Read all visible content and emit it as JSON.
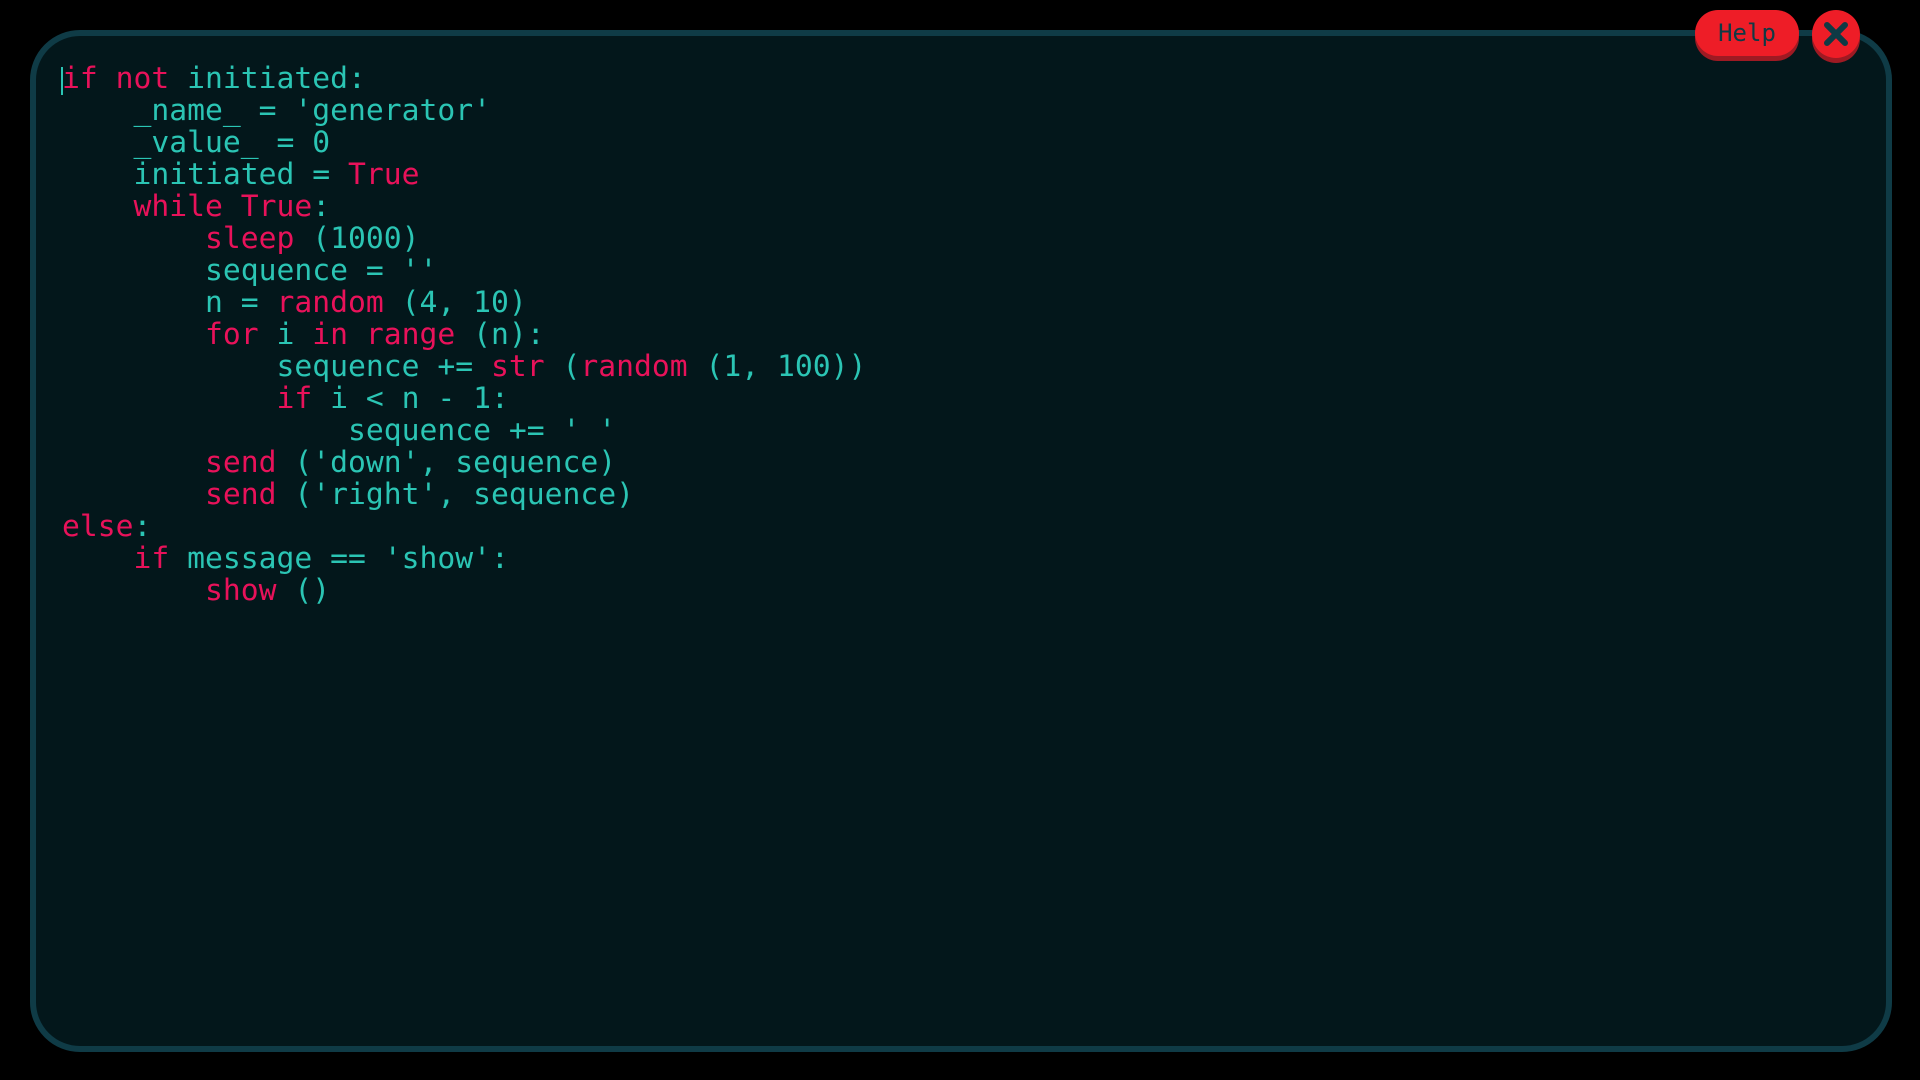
{
  "theme": {
    "background": "#000000",
    "panel_background": "#03171b",
    "panel_border": "#0f3b46",
    "keyword_color": "#e8125a",
    "text_color": "#2bc5b4",
    "button_color": "#ee1d27",
    "button_shadow": "#9e1a23",
    "button_text": "#0f3a45"
  },
  "toolbar": {
    "help_label": "Help",
    "close_icon": "close-x-icon"
  },
  "editor": {
    "language": "python-like script",
    "lines": [
      [
        {
          "t": "kw",
          "v": "if"
        },
        {
          "t": "tx",
          "v": " "
        },
        {
          "t": "kw",
          "v": "not"
        },
        {
          "t": "tx",
          "v": " initiated:"
        }
      ],
      [
        {
          "t": "tx",
          "v": "    _name_ = 'generator'"
        }
      ],
      [
        {
          "t": "tx",
          "v": "    _value_ = 0"
        }
      ],
      [
        {
          "t": "tx",
          "v": "    initiated = "
        },
        {
          "t": "kw",
          "v": "True"
        }
      ],
      [
        {
          "t": "tx",
          "v": "    "
        },
        {
          "t": "kw",
          "v": "while"
        },
        {
          "t": "tx",
          "v": " "
        },
        {
          "t": "kw",
          "v": "True"
        },
        {
          "t": "tx",
          "v": ":"
        }
      ],
      [
        {
          "t": "tx",
          "v": "        "
        },
        {
          "t": "kw",
          "v": "sleep"
        },
        {
          "t": "tx",
          "v": " (1000)"
        }
      ],
      [
        {
          "t": "tx",
          "v": "        sequence = ''"
        }
      ],
      [
        {
          "t": "tx",
          "v": "        n = "
        },
        {
          "t": "kw",
          "v": "random"
        },
        {
          "t": "tx",
          "v": " (4, 10)"
        }
      ],
      [
        {
          "t": "tx",
          "v": "        "
        },
        {
          "t": "kw",
          "v": "for"
        },
        {
          "t": "tx",
          "v": " i "
        },
        {
          "t": "kw",
          "v": "in"
        },
        {
          "t": "tx",
          "v": " "
        },
        {
          "t": "kw",
          "v": "range"
        },
        {
          "t": "tx",
          "v": " (n):"
        }
      ],
      [
        {
          "t": "tx",
          "v": "            sequence += "
        },
        {
          "t": "kw",
          "v": "str"
        },
        {
          "t": "tx",
          "v": " ("
        },
        {
          "t": "kw",
          "v": "random"
        },
        {
          "t": "tx",
          "v": " (1, 100))"
        }
      ],
      [
        {
          "t": "tx",
          "v": "            "
        },
        {
          "t": "kw",
          "v": "if"
        },
        {
          "t": "tx",
          "v": " i < n - 1:"
        }
      ],
      [
        {
          "t": "tx",
          "v": "                sequence += ' '"
        }
      ],
      [
        {
          "t": "tx",
          "v": "        "
        },
        {
          "t": "kw",
          "v": "send"
        },
        {
          "t": "tx",
          "v": " ('down', sequence)"
        }
      ],
      [
        {
          "t": "tx",
          "v": "        "
        },
        {
          "t": "kw",
          "v": "send"
        },
        {
          "t": "tx",
          "v": " ('right', sequence)"
        }
      ],
      [
        {
          "t": "kw",
          "v": "else"
        },
        {
          "t": "tx",
          "v": ":"
        }
      ],
      [
        {
          "t": "tx",
          "v": "    "
        },
        {
          "t": "kw",
          "v": "if"
        },
        {
          "t": "tx",
          "v": " message == 'show':"
        }
      ],
      [
        {
          "t": "tx",
          "v": "        "
        },
        {
          "t": "kw",
          "v": "show"
        },
        {
          "t": "tx",
          "v": " ()"
        }
      ]
    ]
  }
}
